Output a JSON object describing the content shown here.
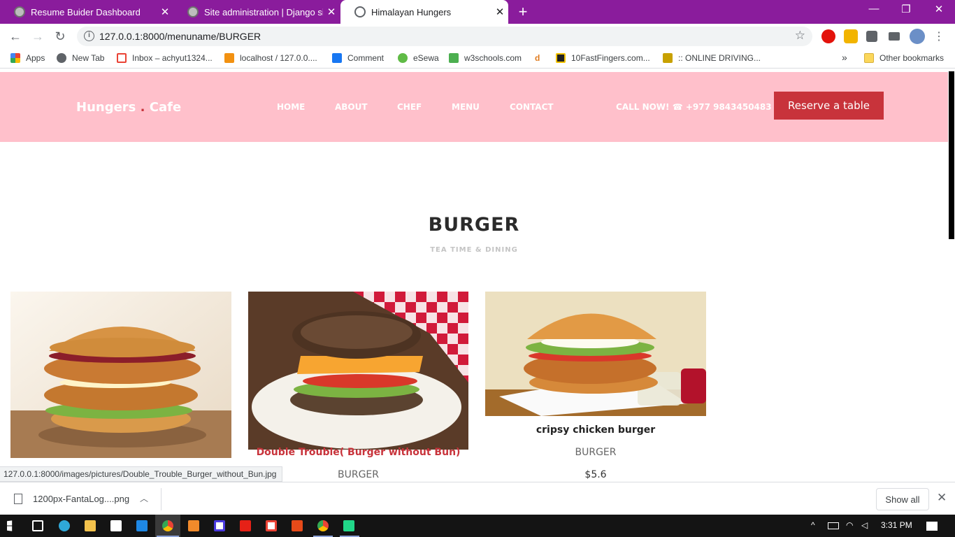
{
  "browser": {
    "tabs": [
      {
        "title": "Resume Buider Dashboard",
        "active": false
      },
      {
        "title": "Site administration | Django site admin",
        "active": false
      },
      {
        "title": "Himalayan Hungers",
        "active": true
      }
    ],
    "new_tab_label": "+",
    "url": "127.0.0.1:8000/menuname/BURGER",
    "bookmarks": [
      {
        "label": "Apps",
        "icon": "apps-grid-icon"
      },
      {
        "label": "New Tab",
        "icon": "globe-icon"
      },
      {
        "label": "Inbox – achyut1324...",
        "icon": "gmail-icon"
      },
      {
        "label": "localhost / 127.0.0....",
        "icon": "phpmyadmin-icon"
      },
      {
        "label": "Comment",
        "icon": "facebook-icon"
      },
      {
        "label": "eSewa",
        "icon": "esewa-icon"
      },
      {
        "label": "w3schools.com",
        "icon": "w3schools-icon"
      },
      {
        "label": "",
        "icon": "d-icon"
      },
      {
        "label": "10FastFingers.com...",
        "icon": "fastfingers-icon"
      },
      {
        "label": ":: ONLINE DRIVING...",
        "icon": "driving-icon"
      }
    ],
    "bookmarks_overflow": "»",
    "other_bookmarks": "Other bookmarks",
    "status_link": "127.0.0.1:8000/images/pictures/Double_Trouble_Burger_without_Bun.jpg"
  },
  "site": {
    "brand_left": "Hungers",
    "brand_dot": " . ",
    "brand_right": "Cafe",
    "nav": [
      "HOME",
      "ABOUT",
      "CHEF",
      "MENU",
      "CONTACT"
    ],
    "call_now": "CALL NOW! ☎ +977 9843450483",
    "reserve_label": "Reserve a table",
    "colors": {
      "header_bg": "#ffc0cb",
      "accent": "#c8333b"
    }
  },
  "menu": {
    "title": "BURGER",
    "subtitle": "TEA TIME & DINING",
    "items": [
      {
        "name": "",
        "category": "",
        "price": "",
        "image": "crispy-zinger-burger"
      },
      {
        "name": "Double Trouble( Burger without Bun)",
        "category": "BURGER",
        "price": "",
        "image": "double-trouble-burger",
        "hovered": true
      },
      {
        "name": "cripsy chicken burger",
        "category": "BURGER",
        "price": "$5.6",
        "image": "crispy-chicken-burger"
      }
    ]
  },
  "downloads": {
    "file": "1200px-FantaLog....png",
    "show_all": "Show all"
  },
  "taskbar": {
    "time": "3:31 PM"
  }
}
